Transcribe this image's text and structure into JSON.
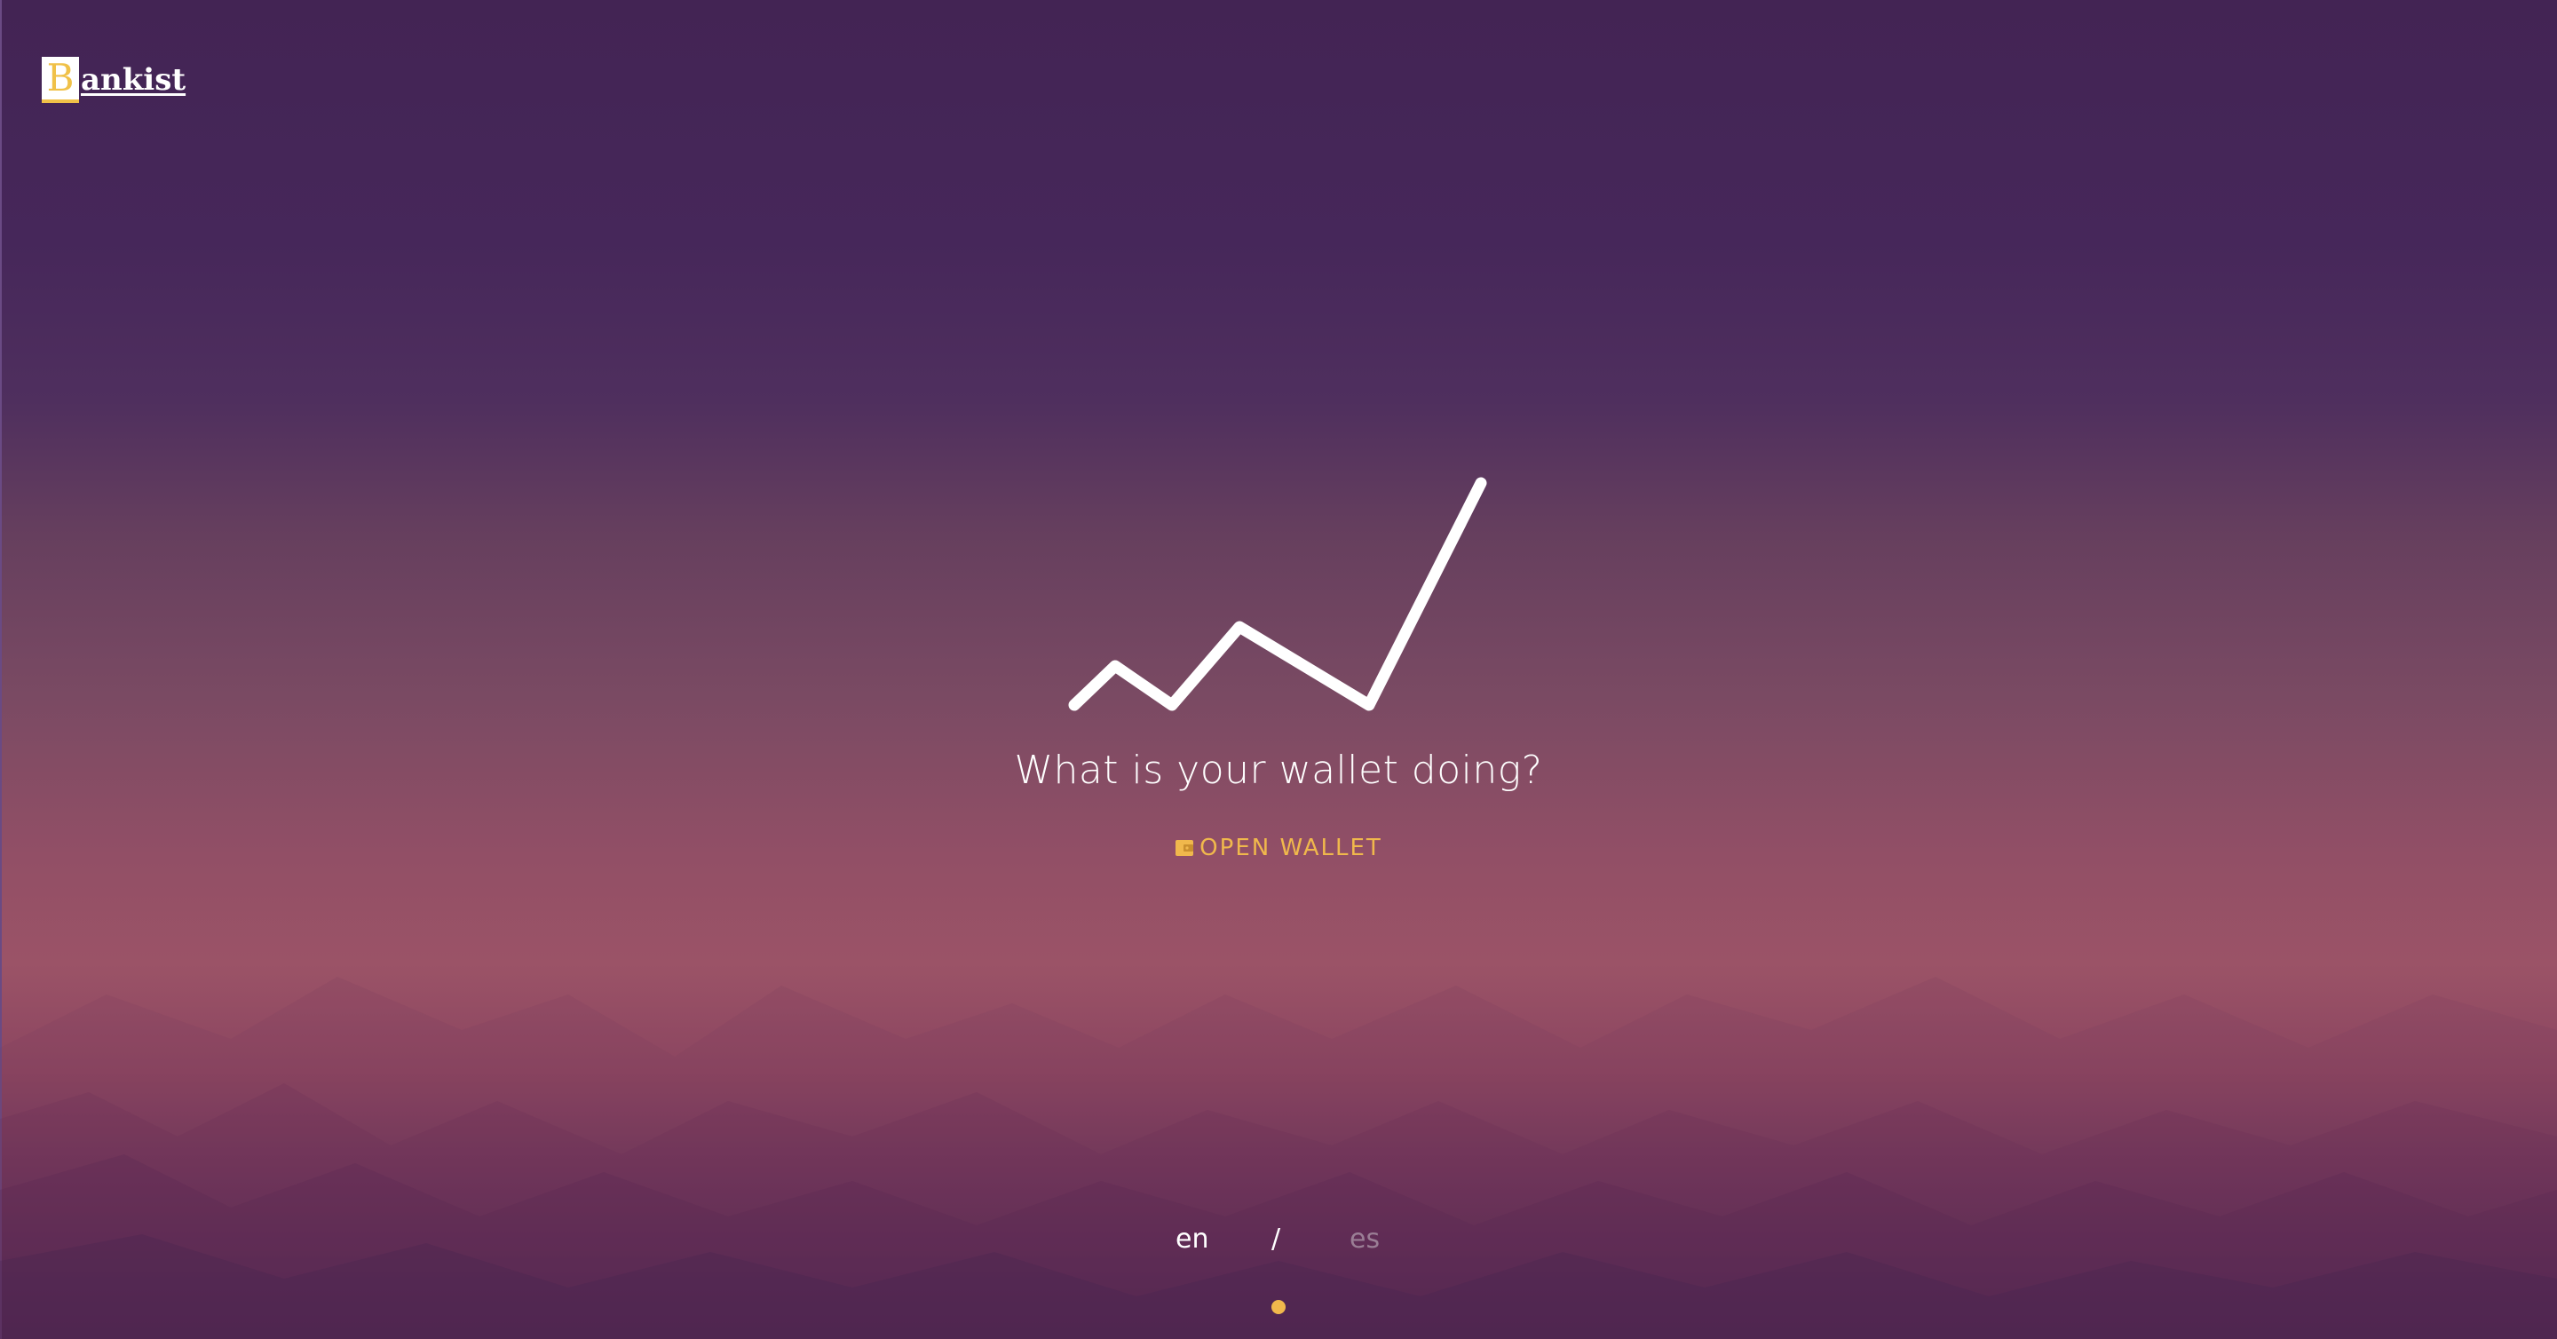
{
  "brand": {
    "initial": "B",
    "rest": "ankist"
  },
  "headline": "What is your wallet doing?",
  "cta": {
    "label": "OPEN WALLET",
    "icon": "wallet-icon"
  },
  "language": {
    "en": "en",
    "separator": "/",
    "es": "es"
  },
  "colors": {
    "accent": "#f0b84c",
    "text": "#ffffff",
    "inactive_lang": "#9a7e95"
  }
}
